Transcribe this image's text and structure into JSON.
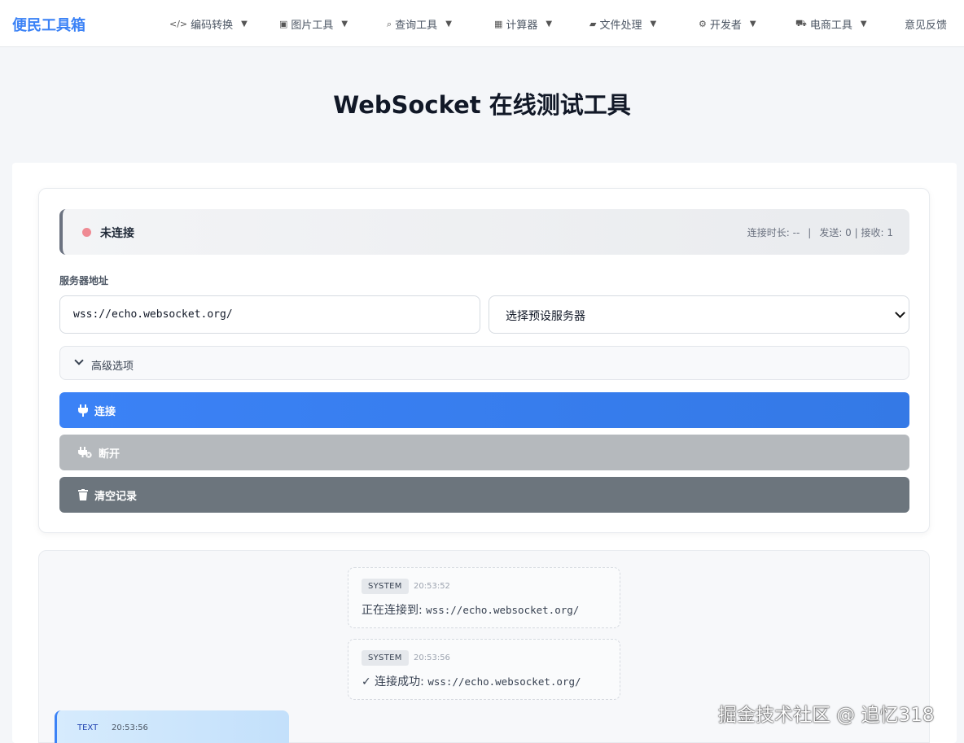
{
  "nav": {
    "brand": "便民工具箱",
    "items": [
      {
        "icon": "</>",
        "label": "编码转换"
      },
      {
        "icon": "▣",
        "label": "图片工具"
      },
      {
        "icon": "⌕",
        "label": "查询工具"
      },
      {
        "icon": "▦",
        "label": "计算器"
      },
      {
        "icon": "▰",
        "label": "文件处理"
      },
      {
        "icon": "⚙",
        "label": "开发者"
      },
      {
        "icon": "⛟",
        "label": "电商工具"
      }
    ],
    "feedback": "意见反馈",
    "caret": "▼"
  },
  "page": {
    "title": "WebSocket 在线测试工具"
  },
  "status": {
    "state": "未连接",
    "duration_label": "连接时长: --",
    "separator": "|",
    "counts": "发送: 0 | 接收: 1",
    "dot_color": "#ef8a93"
  },
  "server": {
    "label": "服务器地址",
    "url": "wss://echo.websocket.org/",
    "preset_selected": "选择预设服务器"
  },
  "advanced": {
    "label": "高级选项"
  },
  "buttons": {
    "connect": "连接",
    "disconnect": "断开",
    "clear": "清空记录"
  },
  "log": {
    "messages": [
      {
        "type": "SYSTEM",
        "time": "20:53:52",
        "prefix": "正在连接到: ",
        "url": "wss://echo.websocket.org/"
      },
      {
        "type": "SYSTEM",
        "time": "20:53:56",
        "prefix": "✓ 连接成功: ",
        "url": "wss://echo.websocket.org/"
      },
      {
        "type": "TEXT",
        "time": "20:53:56"
      }
    ]
  },
  "watermark": "掘金技术社区 @ 追忆318",
  "colors": {
    "accent": "#3b82f6",
    "disconnect": "#b5b9bd",
    "clear": "#6c757d"
  }
}
